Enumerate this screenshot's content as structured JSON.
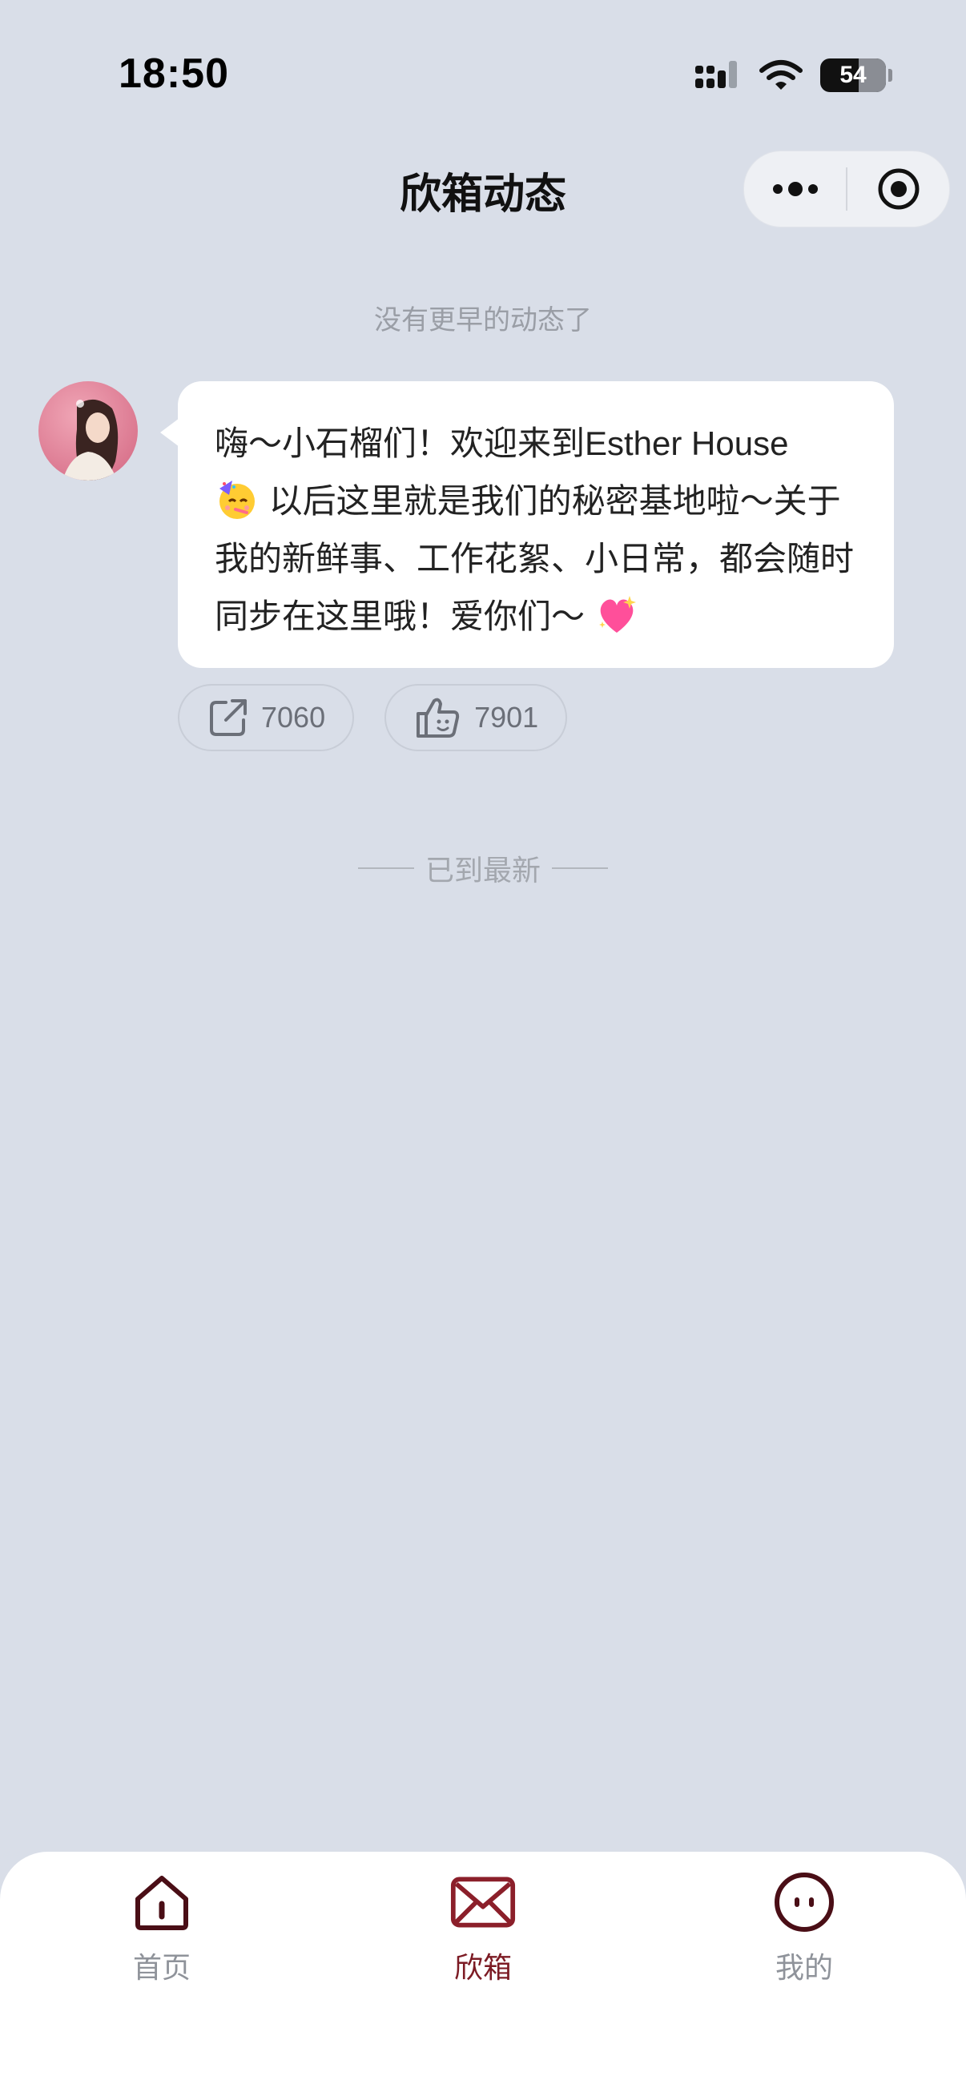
{
  "status_bar": {
    "time": "18:50",
    "battery_level": "54"
  },
  "header": {
    "title": "欣箱动态"
  },
  "feed": {
    "top_hint": "没有更早的动态了",
    "post": {
      "text_part1": "嗨～小石榴们！欢迎来到Esther House",
      "text_part2": " 以后这里就是我们的秘密基地啦～关于我的新鲜事、工作花絮、小日常，都会随时同步在这里哦！爱你们～",
      "share_count": "7060",
      "like_count": "7901"
    },
    "end_hint": "已到最新"
  },
  "tabbar": {
    "items": [
      {
        "label": "首页",
        "icon": "home-icon",
        "active": false
      },
      {
        "label": "欣箱",
        "icon": "mail-icon",
        "active": true
      },
      {
        "label": "我的",
        "icon": "profile-face-icon",
        "active": false
      }
    ]
  },
  "colors": {
    "background": "#d9dee8",
    "accent": "#7c1b24",
    "muted_text": "#9a9ea6"
  }
}
